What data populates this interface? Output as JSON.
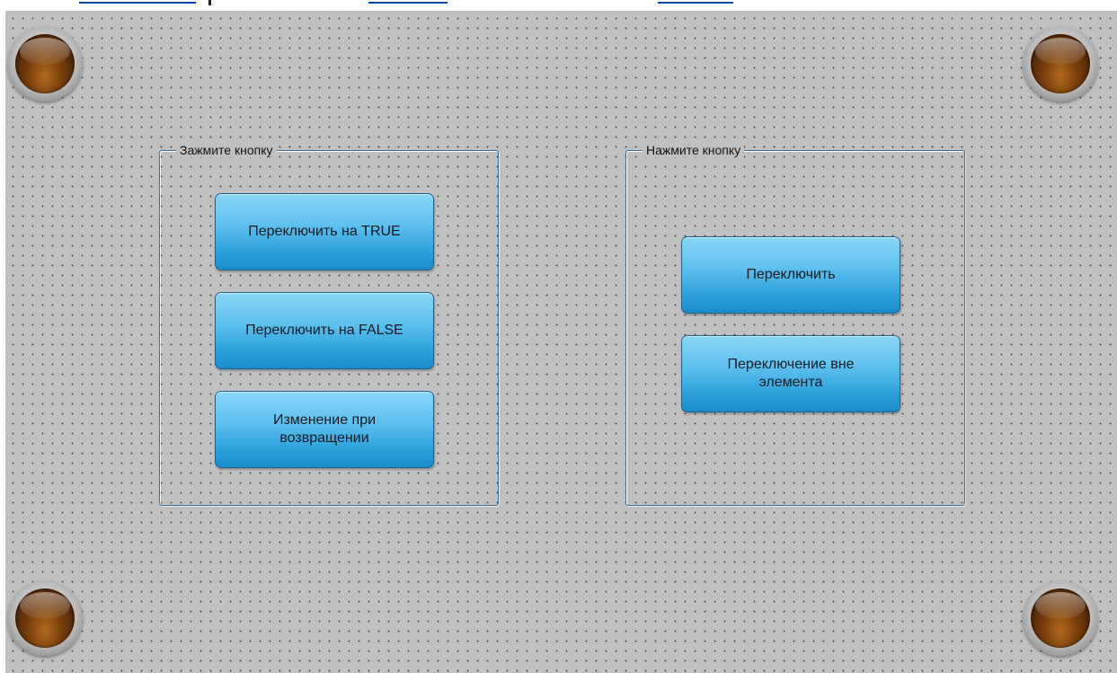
{
  "groups": {
    "hold": {
      "title": "Зажмите кнопку",
      "buttons": [
        {
          "label": "Переключить на TRUE"
        },
        {
          "label": "Переключить на FALSE"
        },
        {
          "label": "Изменение при возвращении"
        }
      ]
    },
    "press": {
      "title": "Нажмите кнопку",
      "buttons": [
        {
          "label": "Переключить"
        },
        {
          "label": "Переключение вне элемента"
        }
      ]
    }
  },
  "lamps": [
    {
      "icon": "lamp-indicator-icon",
      "color": "#7a3f0d"
    },
    {
      "icon": "lamp-indicator-icon",
      "color": "#7a3f0d"
    },
    {
      "icon": "lamp-indicator-icon",
      "color": "#7a3f0d"
    },
    {
      "icon": "lamp-indicator-icon",
      "color": "#7a3f0d"
    }
  ],
  "colors": {
    "background": "#c0c0c0",
    "button": "#2fa2dc",
    "frame": "#3a6e96"
  }
}
